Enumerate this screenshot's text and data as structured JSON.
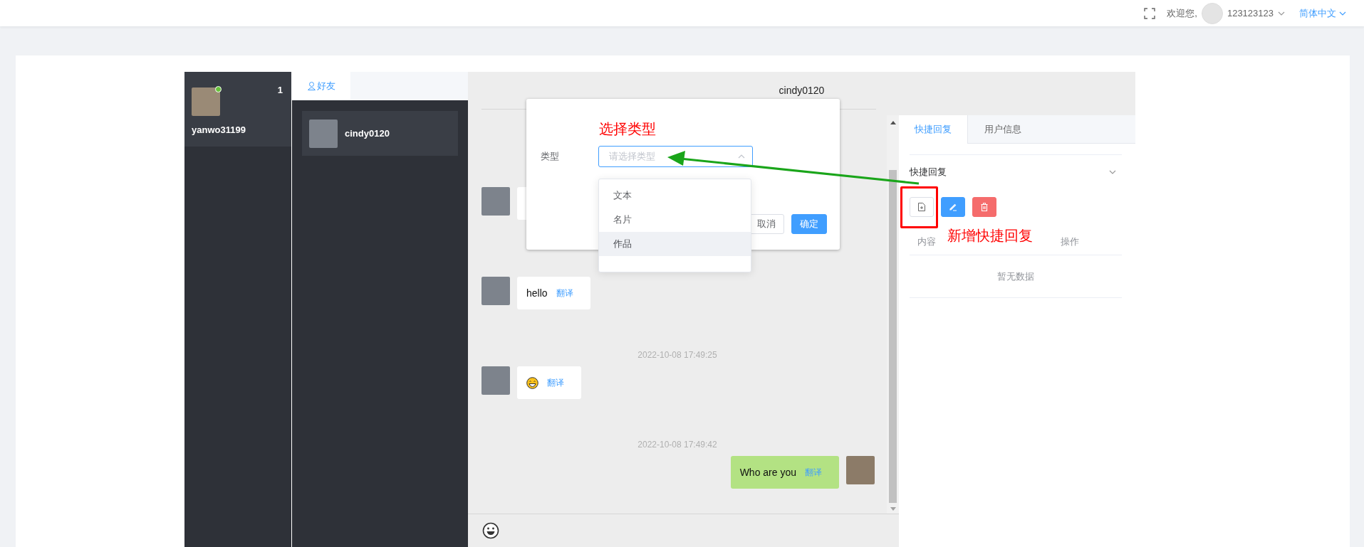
{
  "top_bar": {
    "welcome": "欢迎您,",
    "username": "123123123",
    "language": "简体中文"
  },
  "account": {
    "name": "yanwo31199",
    "online": true,
    "unread": "1"
  },
  "contacts": {
    "tabs": [
      {
        "label": "好友",
        "selected": true
      }
    ],
    "items": [
      {
        "name": "cindy0120",
        "selected": true
      }
    ]
  },
  "chat": {
    "title": "cindy0120",
    "messages": [
      {
        "outgoing": false,
        "kind": "covered"
      },
      {
        "outgoing": false,
        "kind": "text",
        "text": "hello",
        "translate": "翻译"
      },
      {
        "time": "2022-10-08 17:49:25",
        "outgoing": false,
        "kind": "emoji",
        "translate": "翻译"
      },
      {
        "time": "2022-10-08 17:49:42",
        "outgoing": true,
        "kind": "text",
        "text": "Who are you",
        "translate": "翻译"
      }
    ]
  },
  "dialog": {
    "field_label": "类型",
    "placeholder": "请选择类型",
    "open": true,
    "annotation": "选择类型",
    "arrow_annotation": true,
    "options": [
      {
        "label": "文本",
        "highlighted": false
      },
      {
        "label": "名片",
        "highlighted": false
      },
      {
        "label": "作品",
        "highlighted": true
      }
    ],
    "buttons": [
      {
        "label": "取消",
        "kind": "default"
      },
      {
        "label": "确定",
        "kind": "primary"
      }
    ]
  },
  "side_panel": {
    "tabs": [
      {
        "label": "快捷回复",
        "selected": true
      },
      {
        "label": "用户信息",
        "selected": false
      }
    ],
    "section_title": "快捷回复",
    "expanded": true,
    "add_highlighted": true,
    "annotation": "新增快捷回复",
    "columns": [
      "内容",
      "操作"
    ],
    "empty_text": "暂无数据"
  }
}
